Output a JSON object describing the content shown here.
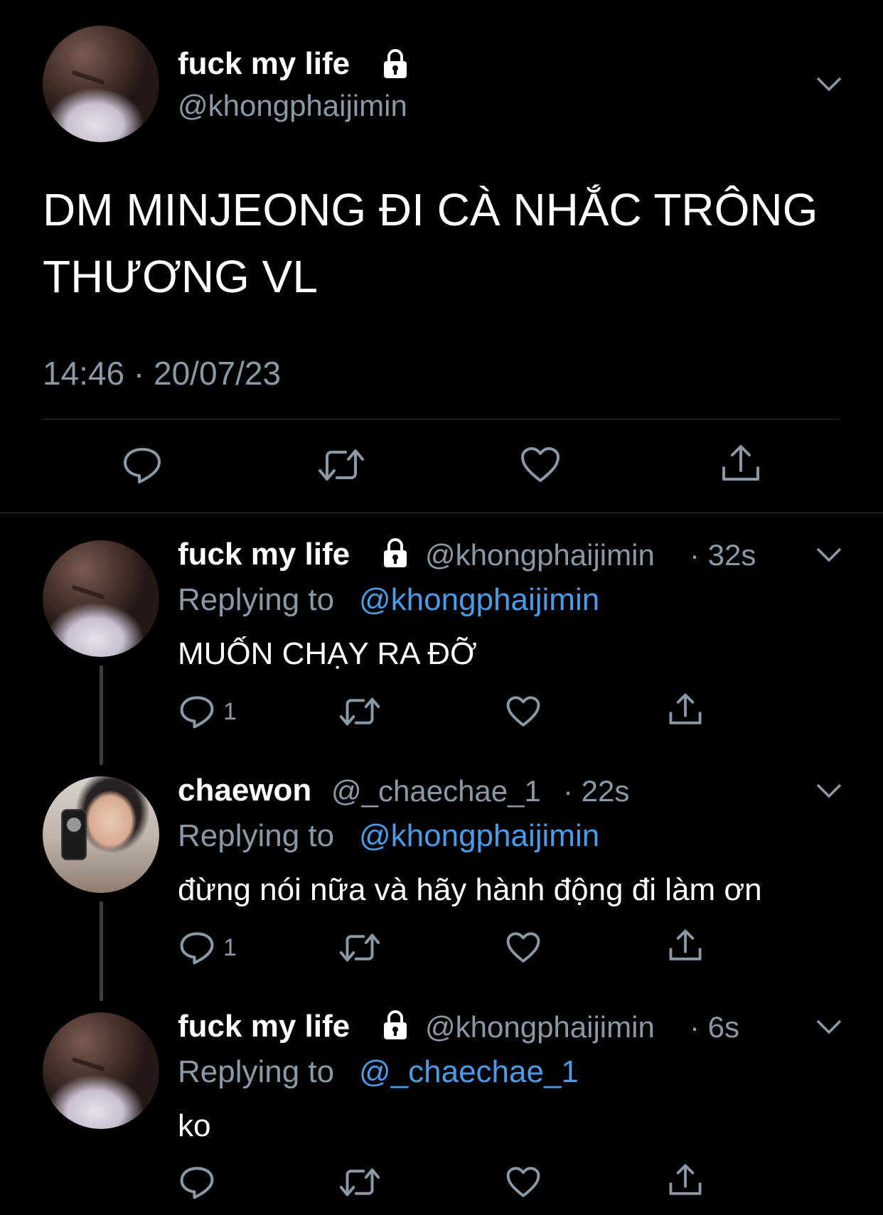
{
  "main_tweet": {
    "display_name": "fuck my life",
    "handle": "@khongphaijimin",
    "text": "DM MINJEONG ĐI CÀ NHẮC TRÔNG THƯƠNG VL",
    "timestamp": "14:46 · 20/07/23"
  },
  "replies": [
    {
      "display_name": "fuck my life",
      "handle": "@khongphaijimin",
      "age": "· 32s",
      "replying_prefix": "Replying to",
      "replying_to": "@khongphaijimin",
      "text": "MUỐN CHẠY RA ĐỠ",
      "reply_count": "1"
    },
    {
      "display_name": "chaewon",
      "handle": "@_chaechae_1",
      "age": "· 22s",
      "replying_prefix": "Replying to",
      "replying_to": "@khongphaijimin",
      "text": "đừng nói nữa và hãy hành động đi làm ơn",
      "reply_count": "1"
    },
    {
      "display_name": "fuck my life",
      "handle": "@khongphaijimin",
      "age": "· 6s",
      "replying_prefix": "Replying to",
      "replying_to": "@_chaechae_1",
      "text": "ko",
      "reply_count": ""
    }
  ],
  "icons": {
    "reply": "reply-icon",
    "retweet": "retweet-icon",
    "like": "heart-icon",
    "share": "share-icon",
    "menu": "chevron-down-icon",
    "protected": "lock-icon"
  },
  "colors": {
    "background": "#000000",
    "link": "#4a9be8",
    "secondary_text": "#8b98a5",
    "divider": "#2f3336"
  }
}
